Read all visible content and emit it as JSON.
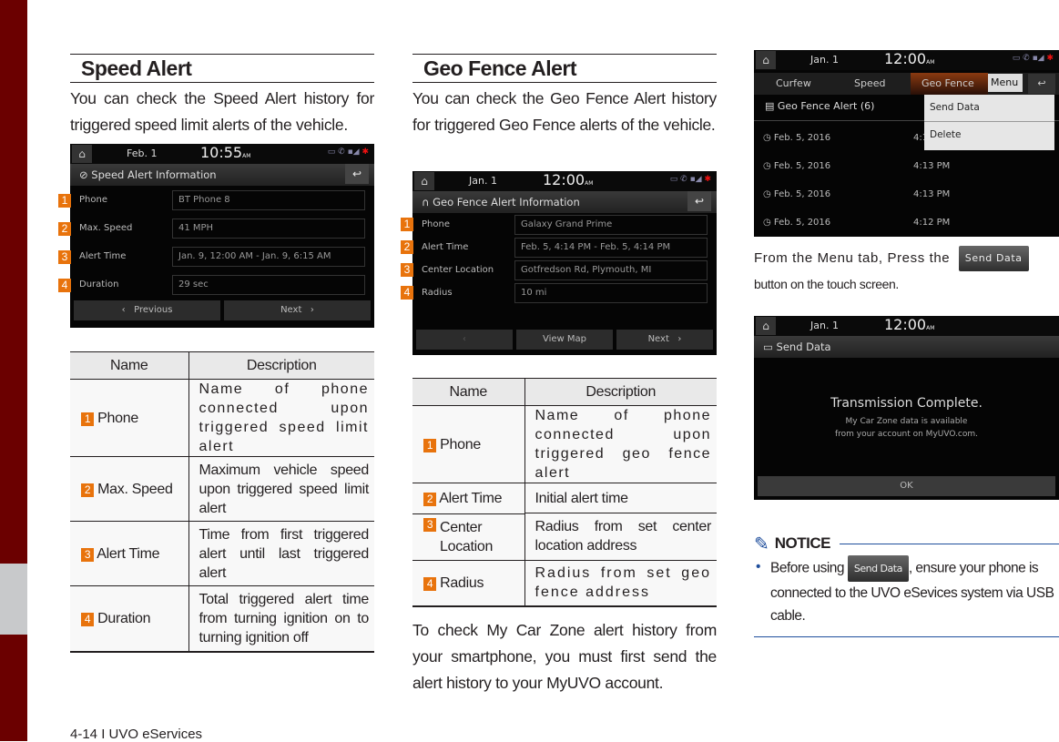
{
  "footer": "4-14 I UVO eServices",
  "speed": {
    "title": "Speed Alert",
    "intro": "You can check the Speed Alert history for triggered speed limit alerts of the vehicle.",
    "screen": {
      "date": "Feb.  1",
      "time": "10:55",
      "ampm": "AM",
      "header": "Speed Alert Information",
      "rows": [
        {
          "label": "Phone",
          "value": "BT Phone 8"
        },
        {
          "label": "Max. Speed",
          "value": "41 MPH"
        },
        {
          "label": "Alert Time",
          "value": "Jan. 9, 12:00 AM - Jan. 9, 6:15 AM"
        },
        {
          "label": "Duration",
          "value": "29 sec"
        }
      ],
      "prev": "Previous",
      "next": "Next"
    },
    "table": {
      "headers": [
        "Name",
        "Description"
      ],
      "rows": [
        {
          "num": "1",
          "name": "Phone",
          "desc": "Name of phone connected upon triggered speed limit alert"
        },
        {
          "num": "2",
          "name": "Max. Speed",
          "desc": "Maximum vehicle speed upon triggered speed limit alert"
        },
        {
          "num": "3",
          "name": "Alert Time",
          "desc": "Time from first triggered alert until last triggered alert"
        },
        {
          "num": "4",
          "name": "Duration",
          "desc": "Total triggered alert time from turning ignition on to turning ignition off"
        }
      ]
    }
  },
  "geo": {
    "title": "Geo Fence Alert",
    "intro": "You can check the Geo Fence Alert history for triggered Geo Fence alerts of the vehicle.",
    "screen": {
      "date": "Jan.  1",
      "time": "12:00",
      "ampm": "AM",
      "header": "Geo Fence Alert Information",
      "rows": [
        {
          "label": "Phone",
          "value": "Galaxy Grand Prime"
        },
        {
          "label": "Alert Time",
          "value": "Feb. 5, 4:14 PM - Feb. 5, 4:14 PM"
        },
        {
          "label": "Center Location",
          "value": "Gotfredson Rd, Plymouth, MI"
        },
        {
          "label": "Radius",
          "value": "10 mi"
        }
      ],
      "view_map": "View Map",
      "next": "Next"
    },
    "table": {
      "headers": [
        "Name",
        "Description"
      ],
      "rows": [
        {
          "num": "1",
          "name": "Phone",
          "desc": "Name of phone connected upon triggered geo fence alert"
        },
        {
          "num": "2",
          "name": "Alert Time",
          "desc": "Initial alert time"
        },
        {
          "num": "3",
          "name": "Center Location",
          "desc": "Radius from set center location address"
        },
        {
          "num": "4",
          "name": "Radius",
          "desc": "Radius from set geo fence address"
        }
      ]
    },
    "outro": "To check My Car Zone alert history from your smartphone, you must first send the alert history to your MyUVO account."
  },
  "send": {
    "list_screen": {
      "date": "Jan.  1",
      "time": "12:00",
      "ampm": "AM",
      "tabs": [
        "Curfew",
        "Speed",
        "Geo Fence"
      ],
      "menu": "Menu",
      "list_title": "Geo Fence Alert (6)",
      "items": [
        {
          "date": "Feb. 5, 2016",
          "time": "4:14 PM"
        },
        {
          "date": "Feb. 5, 2016",
          "time": "4:13 PM"
        },
        {
          "date": "Feb. 5, 2016",
          "time": "4:13 PM"
        },
        {
          "date": "Feb. 5, 2016",
          "time": "4:12 PM"
        }
      ],
      "menu_items": [
        "Send Data",
        "Delete"
      ]
    },
    "instr_a": "From the Menu tab, Press the",
    "button": "Send Data",
    "instr_b": "button on the touch screen.",
    "done_screen": {
      "date": "Jan.  1",
      "time": "12:00",
      "ampm": "AM",
      "header": "Send Data",
      "msg_title": "Transmission Complete.",
      "msg_line1": "My Car Zone data is available",
      "msg_line2": "from your account on MyUVO.com.",
      "ok": "OK"
    },
    "notice": {
      "title": "NOTICE",
      "before": "Before using",
      "after": ", ensure your phone is connected to the UVO eSevices system via USB cable."
    }
  },
  "colors": {
    "sidebar": "#6b0000",
    "callout": "#e8730c",
    "notice_rule": "#1f4e9c"
  }
}
